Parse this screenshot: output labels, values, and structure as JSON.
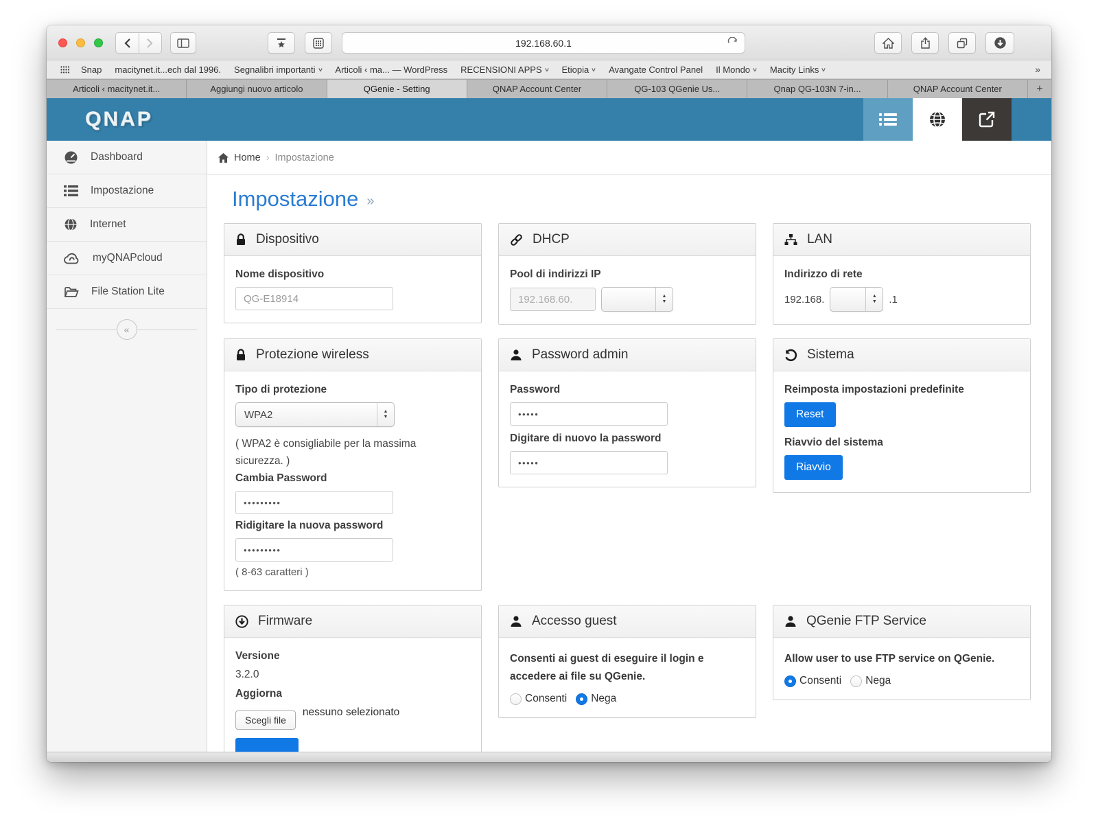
{
  "chrome": {
    "url": "192.168.60.1",
    "dropdown_glyph": "∨",
    "bookmarks": [
      {
        "label": "Snap"
      },
      {
        "label": "macitynet.it...ech dal 1996."
      },
      {
        "label": "Segnalibri importanti",
        "chevron": true
      },
      {
        "label": "Articoli ‹ ma... — WordPress"
      },
      {
        "label": "RECENSIONI APPS",
        "chevron": true
      },
      {
        "label": "Etiopia",
        "chevron": true
      },
      {
        "label": "Avangate Control Panel"
      },
      {
        "label": "Il Mondo",
        "chevron": true
      },
      {
        "label": "Macity Links",
        "chevron": true
      }
    ],
    "bookmarks_overflow": "»",
    "tabs": [
      {
        "label": "Articoli ‹ macitynet.it...",
        "active": false
      },
      {
        "label": "Aggiungi nuovo articolo",
        "active": false
      },
      {
        "label": "QGenie - Setting",
        "active": true
      },
      {
        "label": "QNAP Account Center",
        "active": false
      },
      {
        "label": "QG-103 QGenie Us...",
        "active": false
      },
      {
        "label": "Qnap QG-103N 7-in...",
        "active": false
      },
      {
        "label": "QNAP Account Center",
        "active": false
      }
    ],
    "new_tab": "+"
  },
  "app": {
    "logo": "QNAP",
    "colors": {
      "header_blue": "#3580aa",
      "accent_blue": "#1079e6",
      "title_blue": "#2a7cd2"
    },
    "sidebar": [
      {
        "label": "Dashboard"
      },
      {
        "label": "Impostazione"
      },
      {
        "label": "Internet"
      },
      {
        "label": "myQNAPcloud"
      },
      {
        "label": "File Station Lite"
      }
    ],
    "collapse_glyph": "«",
    "breadcrumb": {
      "home": "Home",
      "separator": "›",
      "current": "Impostazione"
    },
    "title": "Impostazione",
    "title_marker": "»"
  },
  "cards": {
    "device": {
      "title": "Dispositivo",
      "name_label": "Nome dispositivo",
      "name_value": "QG-E18914"
    },
    "dhcp": {
      "title": "DHCP",
      "pool_label": "Pool di indirizzi IP",
      "pool_value": "192.168.60."
    },
    "lan": {
      "title": "LAN",
      "label": "Indirizzo di rete",
      "ip_prefix": "192.168.",
      "ip_suffix": ".1"
    },
    "wireless": {
      "title": "Protezione wireless",
      "type_label": "Tipo di protezione",
      "type_value": "WPA2",
      "type_note": "( WPA2 è consigliabile per la massima sicurezza. )",
      "change_label": "Cambia Password",
      "password_mask": "•••••••••",
      "retype_label": "Ridigitare la nuova password",
      "retype_mask": "•••••••••",
      "length_hint": "( 8-63 caratteri )"
    },
    "admin": {
      "title": "Password admin",
      "password_label": "Password",
      "password_mask": "•••••",
      "retype_label": "Digitare di nuovo la password",
      "retype_mask": "•••••"
    },
    "system": {
      "title": "Sistema",
      "reset_label": "Reimposta impostazioni predefinite",
      "reset_button": "Reset",
      "reboot_label": "Riavvio del sistema",
      "reboot_button": "Riavvio"
    },
    "firmware": {
      "title": "Firmware",
      "version_label": "Versione",
      "version_value": "3.2.0",
      "update_label": "Aggiorna",
      "choose_file": "Scegli file",
      "file_status": "nessuno selezionato"
    },
    "guest": {
      "title": "Accesso guest",
      "description": "Consenti ai guest di eseguire il login e accedere ai file su QGenie.",
      "allow": "Consenti",
      "deny": "Nega",
      "selected": "Nega"
    },
    "ftp": {
      "title": "QGenie FTP Service",
      "description": "Allow user to use FTP service on QGenie.",
      "allow": "Consenti",
      "deny": "Nega",
      "selected": "Consenti"
    }
  }
}
